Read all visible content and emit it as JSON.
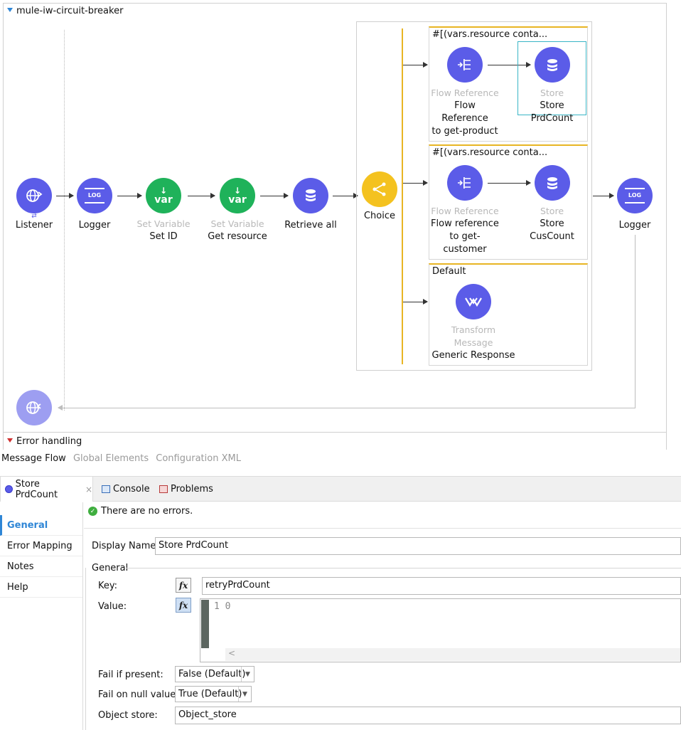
{
  "flow": {
    "name": "mule-iw-circuit-breaker",
    "error_handling": "Error handling",
    "nodes": {
      "listener": {
        "label": "Listener"
      },
      "logger1": {
        "label": "Logger"
      },
      "set_id": {
        "type": "Set Variable",
        "label": "Set ID"
      },
      "get_resource": {
        "type": "Set Variable",
        "label": "Get resource"
      },
      "retrieve_all": {
        "label": "Retrieve all"
      },
      "choice": {
        "label": "Choice"
      },
      "logger2": {
        "label": "Logger"
      }
    },
    "routes": [
      {
        "condition": "#[(vars.resource conta...",
        "flow_ref": {
          "type": "Flow Reference",
          "label_line1": "Flow Reference",
          "label_line2": "to get-product"
        },
        "store": {
          "type": "Store",
          "label_line1": "Store PrdCount"
        }
      },
      {
        "condition": "#[(vars.resource conta...",
        "flow_ref": {
          "type": "Flow Reference",
          "label_line1": "Flow reference",
          "label_line2": "to get-",
          "label_line3": "customer"
        },
        "store": {
          "type": "Store",
          "label_line1": "Store",
          "label_line2": "CusCount"
        }
      },
      {
        "condition": "Default",
        "transform": {
          "type": "Transform Message",
          "label": "Generic Response"
        }
      }
    ],
    "icons": {
      "var_text": "var",
      "log_text": "LOG"
    }
  },
  "view_tabs": {
    "message_flow": "Message Flow",
    "global_elements": "Global Elements",
    "configuration_xml": "Configuration XML"
  },
  "panel": {
    "tabs": {
      "store": "Store PrdCount",
      "console": "Console",
      "problems": "Problems",
      "close": "×"
    },
    "nav": [
      "General",
      "Error Mapping",
      "Notes",
      "Help"
    ],
    "status": "There are no errors.",
    "display_name_label": "Display Name:",
    "display_name_value": "Store PrdCount",
    "group_label": "General",
    "key_label": "Key:",
    "key_value": "retryPrdCount",
    "value_label": "Value:",
    "value_code_line": "1",
    "value_code": "0",
    "fx": "fx",
    "fail_if_present_label": "Fail if present:",
    "fail_if_present_value": "False (Default)",
    "fail_on_null_label": "Fail on null value:",
    "fail_on_null_value": "True (Default)",
    "object_store_label": "Object store:",
    "object_store_value": "Object_store"
  }
}
